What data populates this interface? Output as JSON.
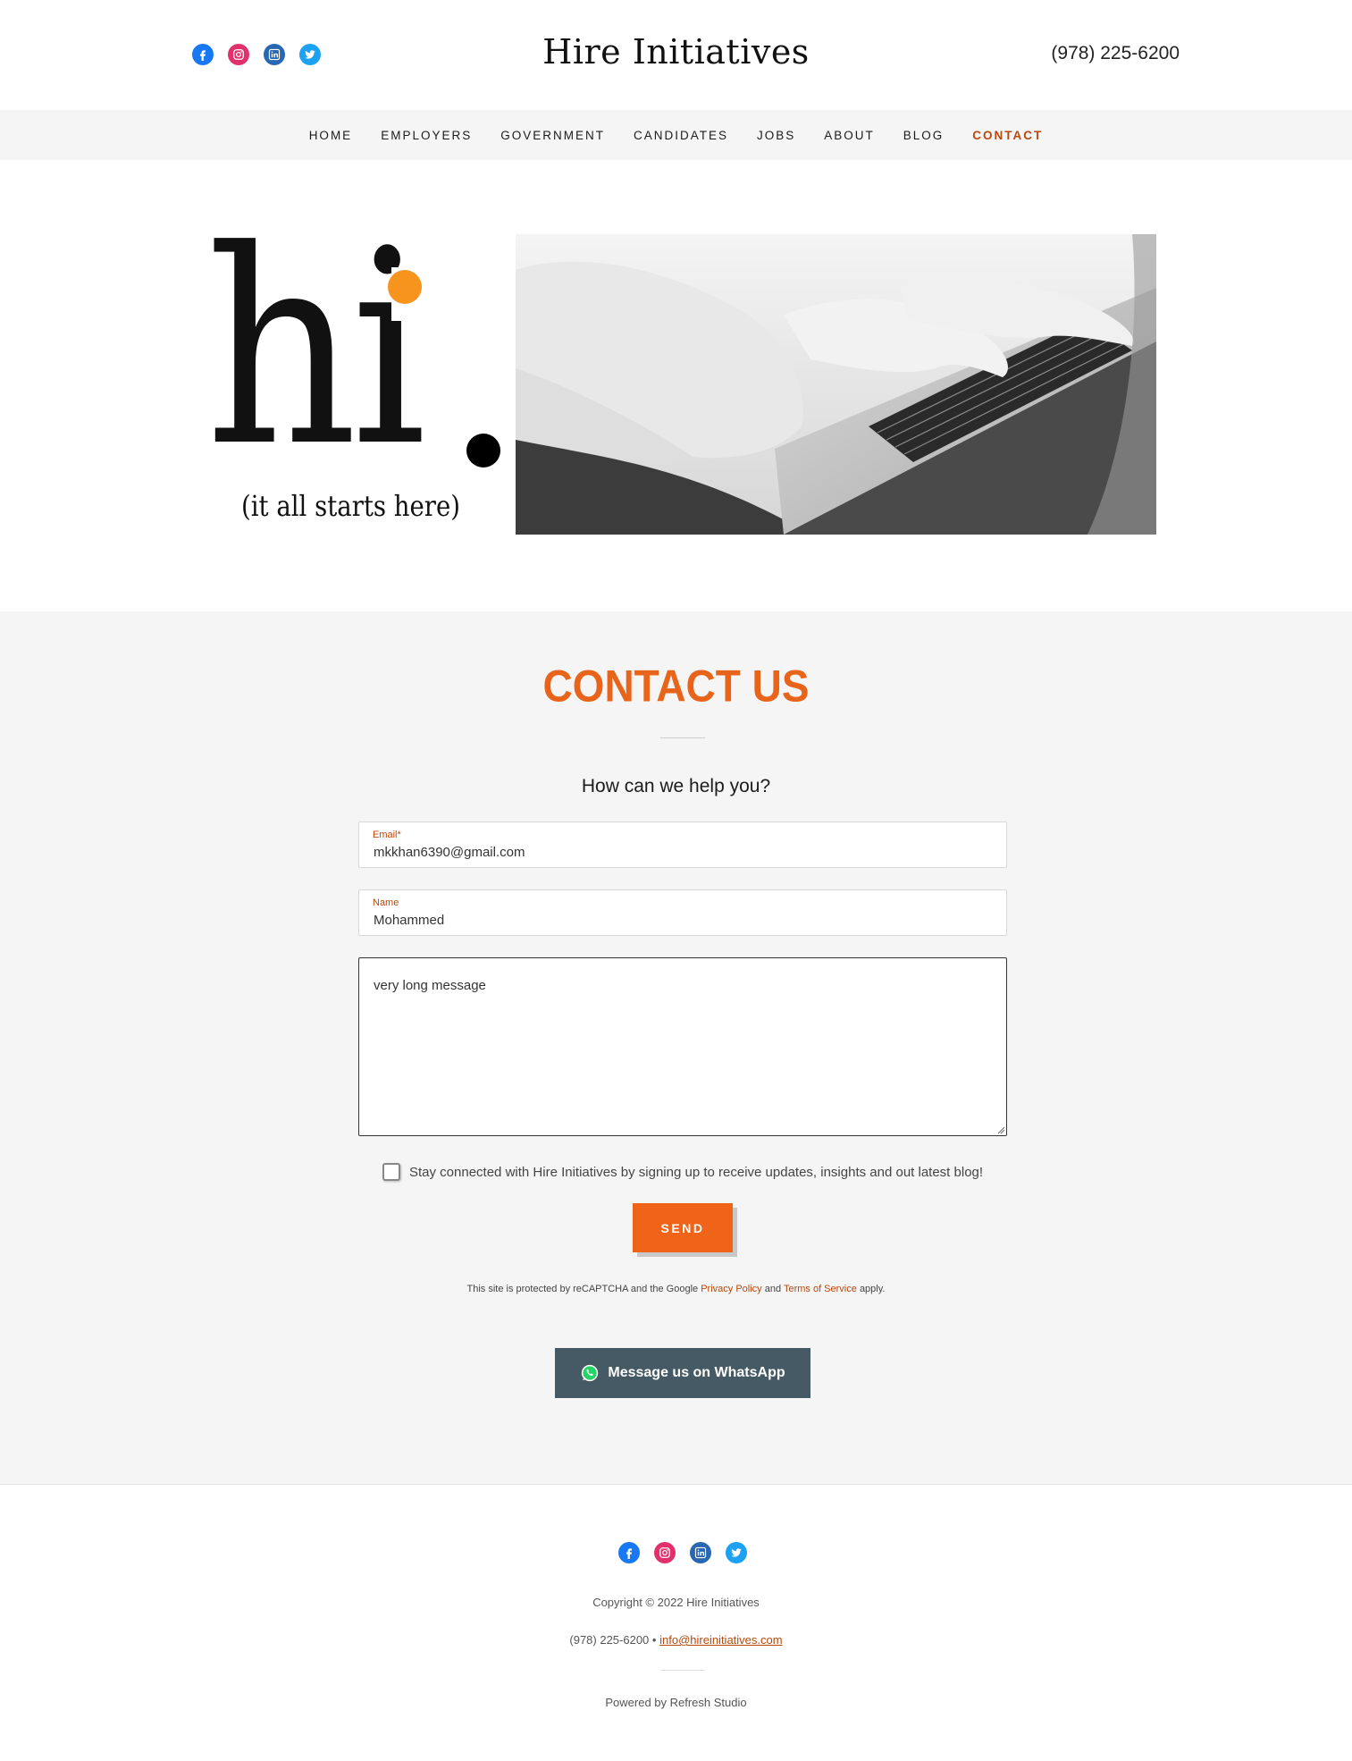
{
  "header": {
    "logo": "Hire Initiatives",
    "phone": "(978) 225-6200",
    "social": [
      "facebook-icon",
      "instagram-icon",
      "linkedin-icon",
      "twitter-icon"
    ]
  },
  "nav": {
    "items": [
      {
        "label": "HOME"
      },
      {
        "label": "EMPLOYERS"
      },
      {
        "label": "GOVERNMENT"
      },
      {
        "label": "CANDIDATES"
      },
      {
        "label": "JOBS"
      },
      {
        "label": "ABOUT"
      },
      {
        "label": "BLOG"
      },
      {
        "label": "CONTACT",
        "active": true
      }
    ]
  },
  "hero": {
    "hi": "hi",
    "tagline": "(it all starts here)",
    "photo_icon": "laptop-typing-photo"
  },
  "contact": {
    "title": "CONTACT US",
    "subtitle": "How can we help you?",
    "email_label": "Email*",
    "email_value": "mkkhan6390@gmail.com",
    "name_label": "Name",
    "name_value": "Mohammed",
    "message_value": "very long message",
    "checkbox_label": "Stay connected with Hire Initiatives by signing up to receive updates, insights and out latest blog!",
    "send_label": "SEND",
    "recaptcha_prefix": "This site is protected by reCAPTCHA and the Google",
    "privacy_label": "Privacy Policy",
    "recaptcha_and": "and",
    "terms_label": "Terms of Service",
    "recaptcha_suffix": "apply.",
    "whatsapp_label": "Message us on WhatsApp"
  },
  "footer": {
    "copyright": "Copyright © 2022 Hire Initiatives",
    "phone": "(978) 225-6200",
    "separator": "•",
    "email": "info@hireinitiatives.com",
    "powered": "Powered by Refresh Studio"
  },
  "colors": {
    "accent": "#e8641b",
    "send_button": "#ef6418",
    "link": "#b8480c",
    "whatsapp_button": "#455a64",
    "hi_dot": "#f7941d"
  }
}
